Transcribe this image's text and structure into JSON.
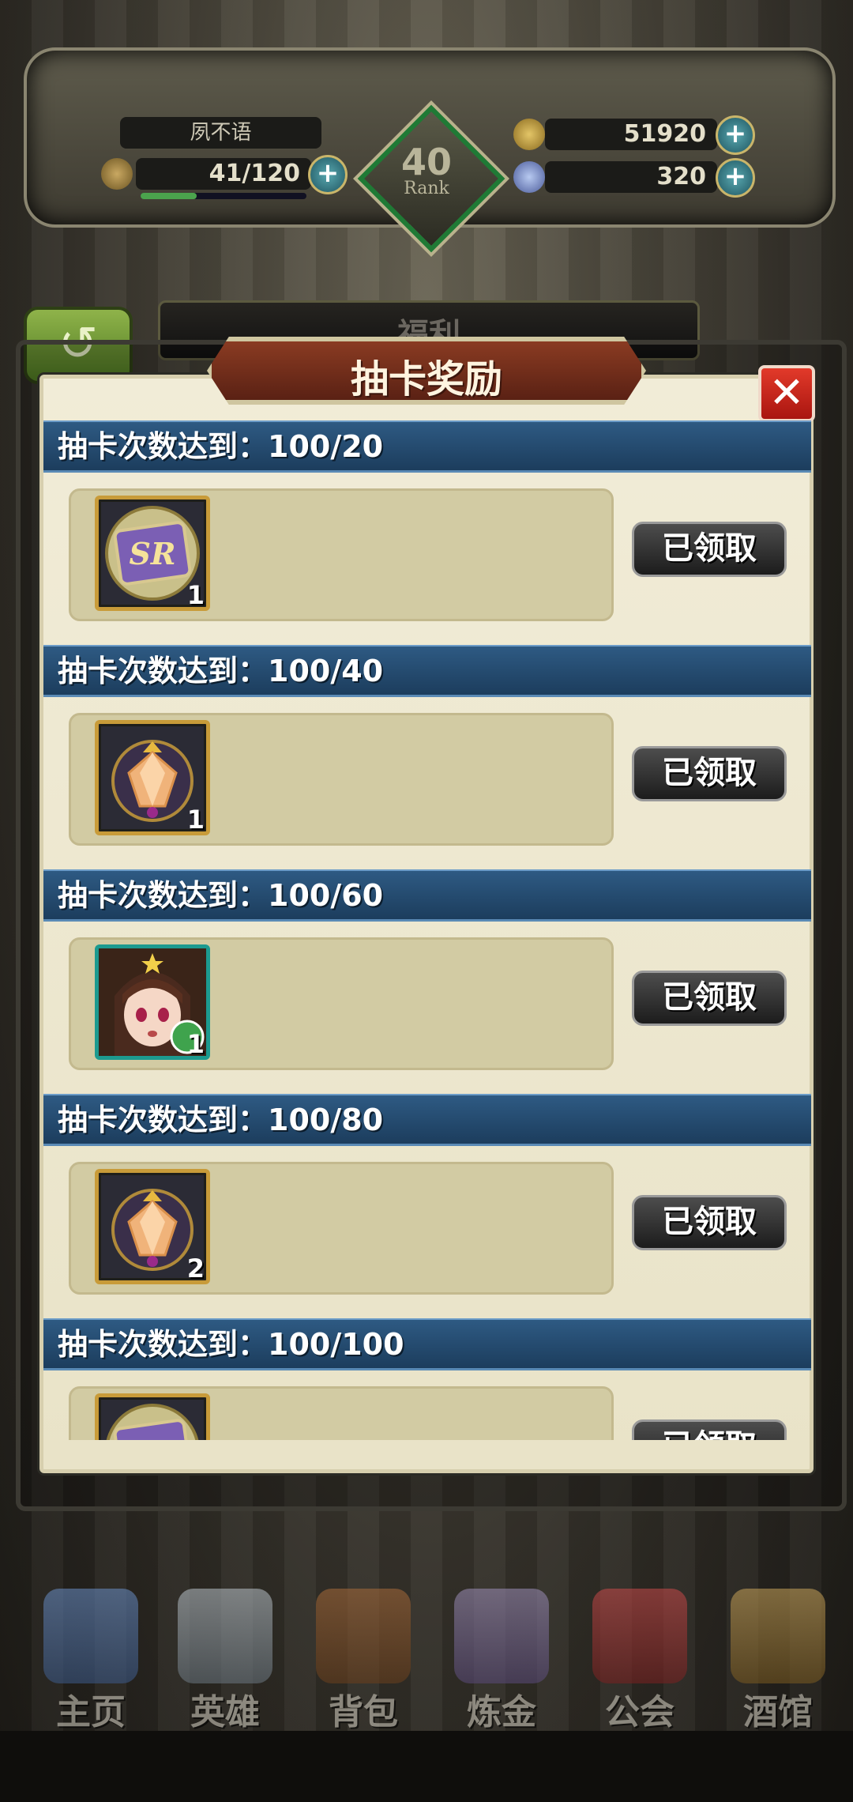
{
  "hud": {
    "player_name": "夙不语",
    "stamina": "41/120",
    "gold": "51920",
    "gems": "320",
    "rank_number": "40",
    "rank_label": "Rank"
  },
  "under_tab": {
    "title": "福利"
  },
  "dialog": {
    "title": "抽卡奖励",
    "close_icon": "close-icon",
    "rows": [
      {
        "header": "抽卡次数达到：100/20",
        "item": "sr-card-icon",
        "qty": "1",
        "button": "已领取"
      },
      {
        "header": "抽卡次数达到：100/40",
        "item": "crystal-emblem-icon",
        "qty": "1",
        "button": "已领取"
      },
      {
        "header": "抽卡次数达到：100/60",
        "item": "hero-portrait-icon",
        "qty": "1",
        "button": "已领取"
      },
      {
        "header": "抽卡次数达到：100/80",
        "item": "crystal-emblem-icon",
        "qty": "2",
        "button": "已领取"
      },
      {
        "header": "抽卡次数达到：100/100",
        "item": "sr-card-icon",
        "qty": "",
        "button": "已领取"
      }
    ]
  },
  "nav": [
    {
      "label": "主页",
      "icon": "castle-icon"
    },
    {
      "label": "英雄",
      "icon": "hero-helmet-icon"
    },
    {
      "label": "背包",
      "icon": "backpack-icon"
    },
    {
      "label": "炼金",
      "icon": "alchemy-icon"
    },
    {
      "label": "公会",
      "icon": "guild-shield-icon"
    },
    {
      "label": "酒馆",
      "icon": "tavern-icon"
    }
  ],
  "colors": {
    "header_blue": "#2e5a83",
    "title_red": "#8a3b22",
    "close_red": "#e23a2a"
  }
}
